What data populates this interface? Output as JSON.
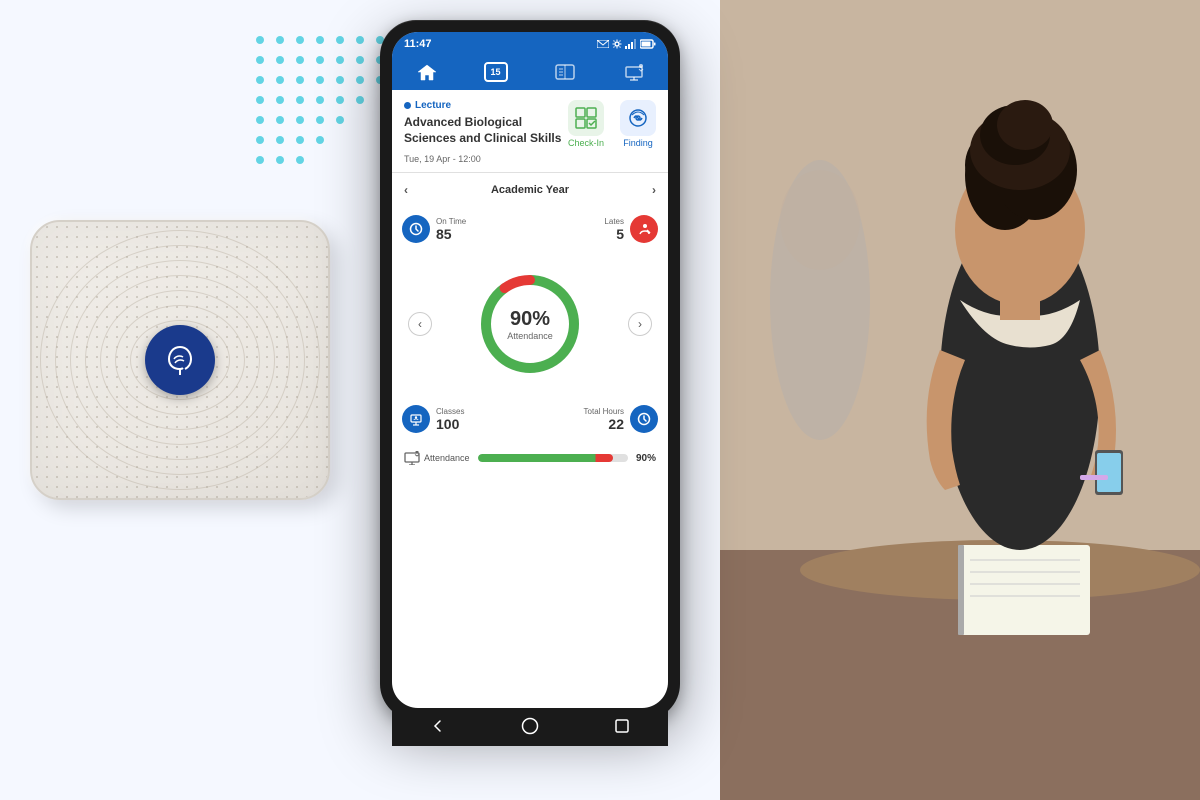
{
  "background": {
    "color": "#f0f4ff"
  },
  "dots": {
    "color": "#26c6da"
  },
  "phone": {
    "status_bar": {
      "time": "11:47",
      "icons": "⊡ ✦ ⊡ ▲ ◼"
    },
    "nav_items": [
      {
        "id": "home",
        "label": "",
        "active": true
      },
      {
        "id": "calendar",
        "label": "15",
        "active": false
      },
      {
        "id": "book",
        "label": "",
        "active": false
      },
      {
        "id": "class",
        "label": "",
        "active": false
      }
    ],
    "lecture": {
      "type": "Lecture",
      "title": "Advanced Biological Sciences and Clinical Skills",
      "date": "Tue, 19 Apr - 12:00",
      "checkin_label": "Check-In",
      "finding_label": "Finding"
    },
    "year_nav": {
      "left_arrow": "‹",
      "label": "Academic Year",
      "right_arrow": "›"
    },
    "stats": {
      "on_time_label": "On Time",
      "on_time_value": "85",
      "lates_label": "Lates",
      "lates_value": "5"
    },
    "donut": {
      "percent": "90%",
      "sub_label": "Attendance",
      "green_pct": 90,
      "red_pct": 10
    },
    "bottom_stats": {
      "classes_label": "Classes",
      "classes_value": "100",
      "hours_label": "Total Hours",
      "hours_value": "22"
    },
    "progress_bar": {
      "label": "Attendance",
      "percent": "90%",
      "fill": 90
    }
  }
}
